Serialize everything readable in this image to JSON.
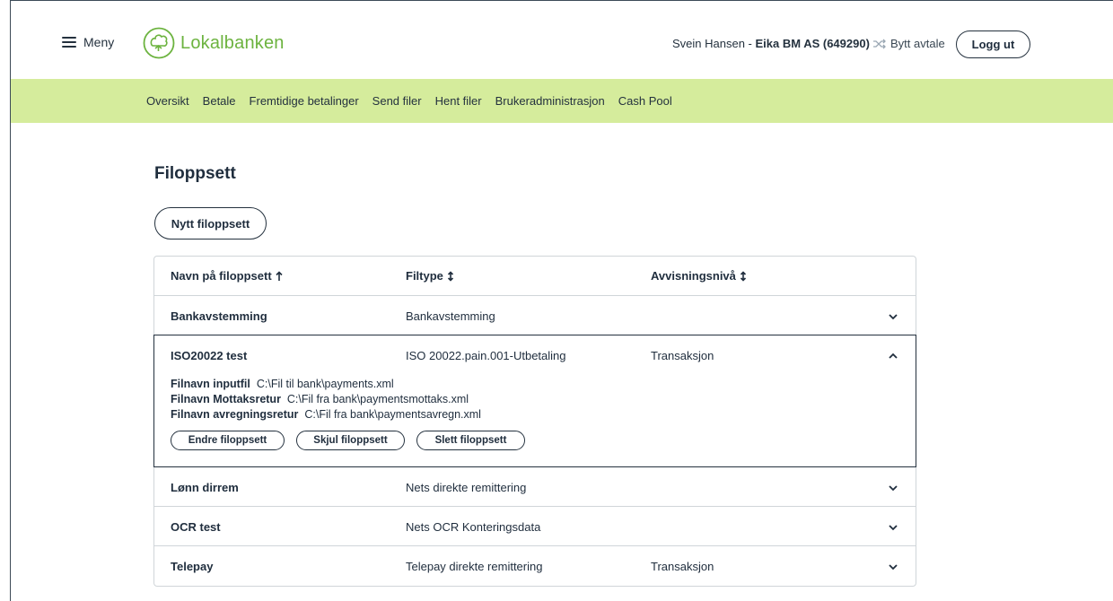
{
  "header": {
    "menu_label": "Meny",
    "logo_text": "Lokalbanken",
    "user_name": "Svein Hansen - ",
    "agreement": "Eika BM AS (649290)",
    "switch_label": "Bytt avtale",
    "logout_label": "Logg ut",
    "accent_color": "#6cb33f"
  },
  "nav": {
    "items": [
      "Oversikt",
      "Betale",
      "Fremtidige betalinger",
      "Send filer",
      "Hent filer",
      "Brukeradministrasjon",
      "Cash Pool"
    ],
    "background_color": "#d5ec9c"
  },
  "page": {
    "title": "Filoppsett",
    "new_button": "Nytt filoppsett"
  },
  "table": {
    "columns": [
      {
        "label": "Navn på filoppsett",
        "sort_icon": "arrow-up-icon"
      },
      {
        "label": "Filtype",
        "sort_icon": "sort-both-icon"
      },
      {
        "label": "Avvisningsnivå",
        "sort_icon": "sort-both-icon"
      }
    ],
    "rows": [
      {
        "name": "Bankavstemming",
        "filetype": "Bankavstemming",
        "level": "",
        "expanded": false
      },
      {
        "name": "ISO20022 test",
        "filetype": "ISO 20022.pain.001-Utbetaling",
        "level": "Transaksjon",
        "expanded": true,
        "details": {
          "input_label": "Filnavn inputfil",
          "input_value": "C:\\Fil til bank\\payments.xml",
          "receipt_label": "Filnavn Mottaksretur",
          "receipt_value": "C:\\Fil fra bank\\paymentsmottaks.xml",
          "settlement_label": "Filnavn avregningsretur",
          "settlement_value": "C:\\Fil fra bank\\paymentsavregn.xml"
        },
        "actions": {
          "edit": "Endre filoppsett",
          "hide": "Skjul filoppsett",
          "delete": "Slett filoppsett"
        }
      },
      {
        "name": "Lønn dirrem",
        "filetype": "Nets direkte remittering",
        "level": "",
        "expanded": false
      },
      {
        "name": "OCR test",
        "filetype": "Nets OCR Konteringsdata",
        "level": "",
        "expanded": false
      },
      {
        "name": "Telepay",
        "filetype": "Telepay direkte remittering",
        "level": "Transaksjon",
        "expanded": false
      }
    ]
  }
}
